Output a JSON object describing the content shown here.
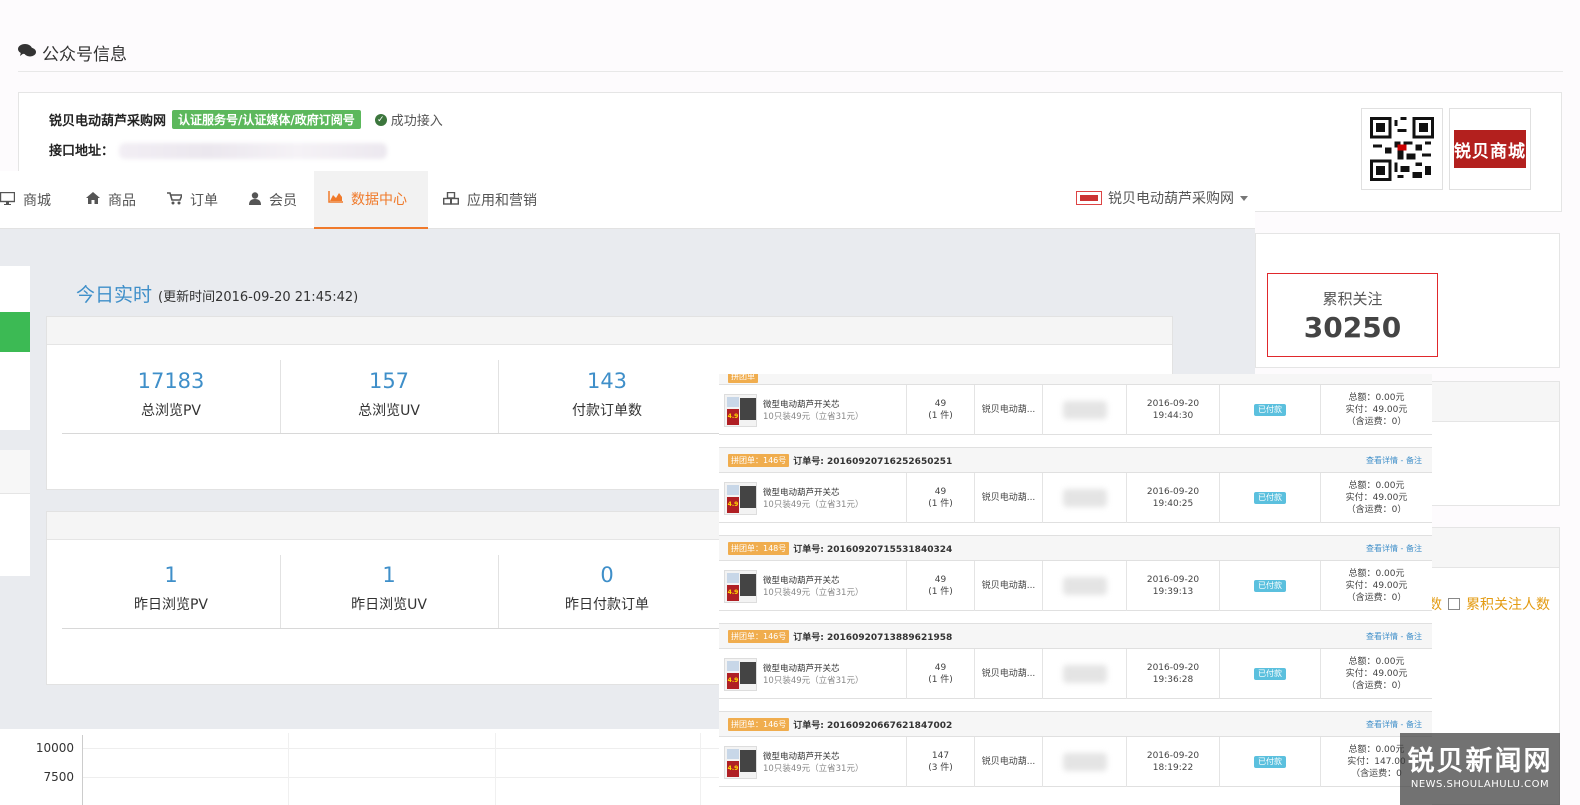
{
  "background_page": {
    "section_title": "公众号信息",
    "account": {
      "name": "锐贝电动葫芦采购网",
      "verify_badge": "认证服务号/认证媒体/政府订阅号",
      "status_text": "成功接入",
      "api_label": "接口地址："
    },
    "total_follow": {
      "label": "累积关注",
      "value": "30250"
    },
    "legend_label": "累积关注人数"
  },
  "nav": {
    "items": [
      {
        "label": "商城",
        "icon": "monitor-icon"
      },
      {
        "label": "商品",
        "icon": "home-icon"
      },
      {
        "label": "订单",
        "icon": "cart-icon"
      },
      {
        "label": "会员",
        "icon": "user-icon"
      },
      {
        "label": "数据中心",
        "icon": "area-chart-icon",
        "active": true
      },
      {
        "label": "应用和营销",
        "icon": "cubes-icon"
      }
    ],
    "store_selector": "锐贝电动葫芦采购网",
    "accent_color": "#f07a2b"
  },
  "realtime": {
    "title": "今日实时",
    "update_time": "(更新时间2016-09-20 21:45:42)"
  },
  "today_stats": [
    {
      "value": "17183",
      "label": "总浏览PV"
    },
    {
      "value": "157",
      "label": "总浏览UV"
    },
    {
      "value": "143",
      "label": "付款订单数"
    }
  ],
  "yesterday_stats": [
    {
      "value": "1",
      "label": "昨日浏览PV"
    },
    {
      "value": "1",
      "label": "昨日浏览UV"
    },
    {
      "value": "0",
      "label": "昨日付款订单"
    }
  ],
  "chart_ticks": [
    "10000",
    "7500"
  ],
  "orders": {
    "links": "查看详情 - 备注",
    "rows": [
      {
        "tag": "",
        "order_no": "",
        "product": "微型电动葫芦开关芯",
        "desc": "10只装49元（立省31元）",
        "price": "49",
        "qty": "(1 件)",
        "shop": "锐贝电动葫...",
        "date": "2016-09-20",
        "time": "19:44:30",
        "status": "已付款",
        "total": "总额：0.00元",
        "paid": "实付：49.00元",
        "freight": "（含运费：0）"
      },
      {
        "tag": "拼团单：146号",
        "order_no": "订单号: 20160920716252650251",
        "product": "微型电动葫芦开关芯",
        "desc": "10只装49元（立省31元）",
        "price": "49",
        "qty": "(1 件)",
        "shop": "锐贝电动葫...",
        "date": "2016-09-20",
        "time": "19:40:25",
        "status": "已付款",
        "total": "总额：0.00元",
        "paid": "实付：49.00元",
        "freight": "（含运费：0）"
      },
      {
        "tag": "拼团单：148号",
        "order_no": "订单号: 20160920715531840324",
        "product": "微型电动葫芦开关芯",
        "desc": "10只装49元（立省31元）",
        "price": "49",
        "qty": "(1 件)",
        "shop": "锐贝电动葫...",
        "date": "2016-09-20",
        "time": "19:39:13",
        "status": "已付款",
        "total": "总额：0.00元",
        "paid": "实付：49.00元",
        "freight": "（含运费：0）"
      },
      {
        "tag": "拼团单：146号",
        "order_no": "订单号: 20160920713889621958",
        "product": "微型电动葫芦开关芯",
        "desc": "10只装49元（立省31元）",
        "price": "49",
        "qty": "(1 件)",
        "shop": "锐贝电动葫...",
        "date": "2016-09-20",
        "time": "19:36:28",
        "status": "已付款",
        "total": "总额：0.00元",
        "paid": "实付：49.00元",
        "freight": "（含运费：0）"
      },
      {
        "tag": "拼团单：146号",
        "order_no": "订单号: 20160920667621847002",
        "product": "微型电动葫芦开关芯",
        "desc": "10只装49元（立省31元）",
        "price": "147",
        "qty": "(3 件)",
        "shop": "锐贝电动葫...",
        "date": "2016-09-20",
        "time": "18:19:22",
        "status": "已付款",
        "total": "总额：0.00元",
        "paid": "实付：147.00",
        "freight": "（含运费：0"
      }
    ]
  },
  "watermark": {
    "main": "锐贝新闻网",
    "sub": "NEWS.SHOULAHULU.COM"
  },
  "logo_text": "锐贝商城"
}
